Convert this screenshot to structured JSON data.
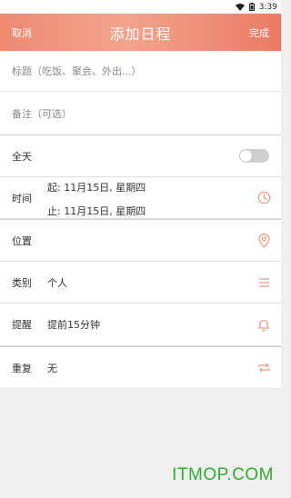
{
  "status_bar": {
    "time": "3:39"
  },
  "header": {
    "cancel_label": "取消",
    "title": "添加日程",
    "done_label": "完成"
  },
  "title_field": {
    "placeholder": "标题（吃饭、聚会、外出...）"
  },
  "note_field": {
    "placeholder": "备注（可选）"
  },
  "all_day": {
    "label": "全天",
    "enabled": false
  },
  "time": {
    "label": "时间",
    "start": "起: 11月15日, 星期四",
    "end": "止: 11月15日, 星期四"
  },
  "location": {
    "label": "位置",
    "value": ""
  },
  "category": {
    "label": "类别",
    "value": "个人"
  },
  "reminder": {
    "label": "提醒",
    "value": "提前15分钟"
  },
  "repeat": {
    "label": "重复",
    "value": "无"
  },
  "watermark": {
    "text": "ITMOP.COM"
  },
  "colors": {
    "accent": "#ee8a72",
    "icon": "#ee9a86",
    "watermark": "#2fae2f"
  },
  "icons": {
    "time": "clock-icon",
    "location": "location-pin-icon",
    "category": "menu-lines-icon",
    "reminder": "bell-icon",
    "repeat": "repeat-icon"
  }
}
